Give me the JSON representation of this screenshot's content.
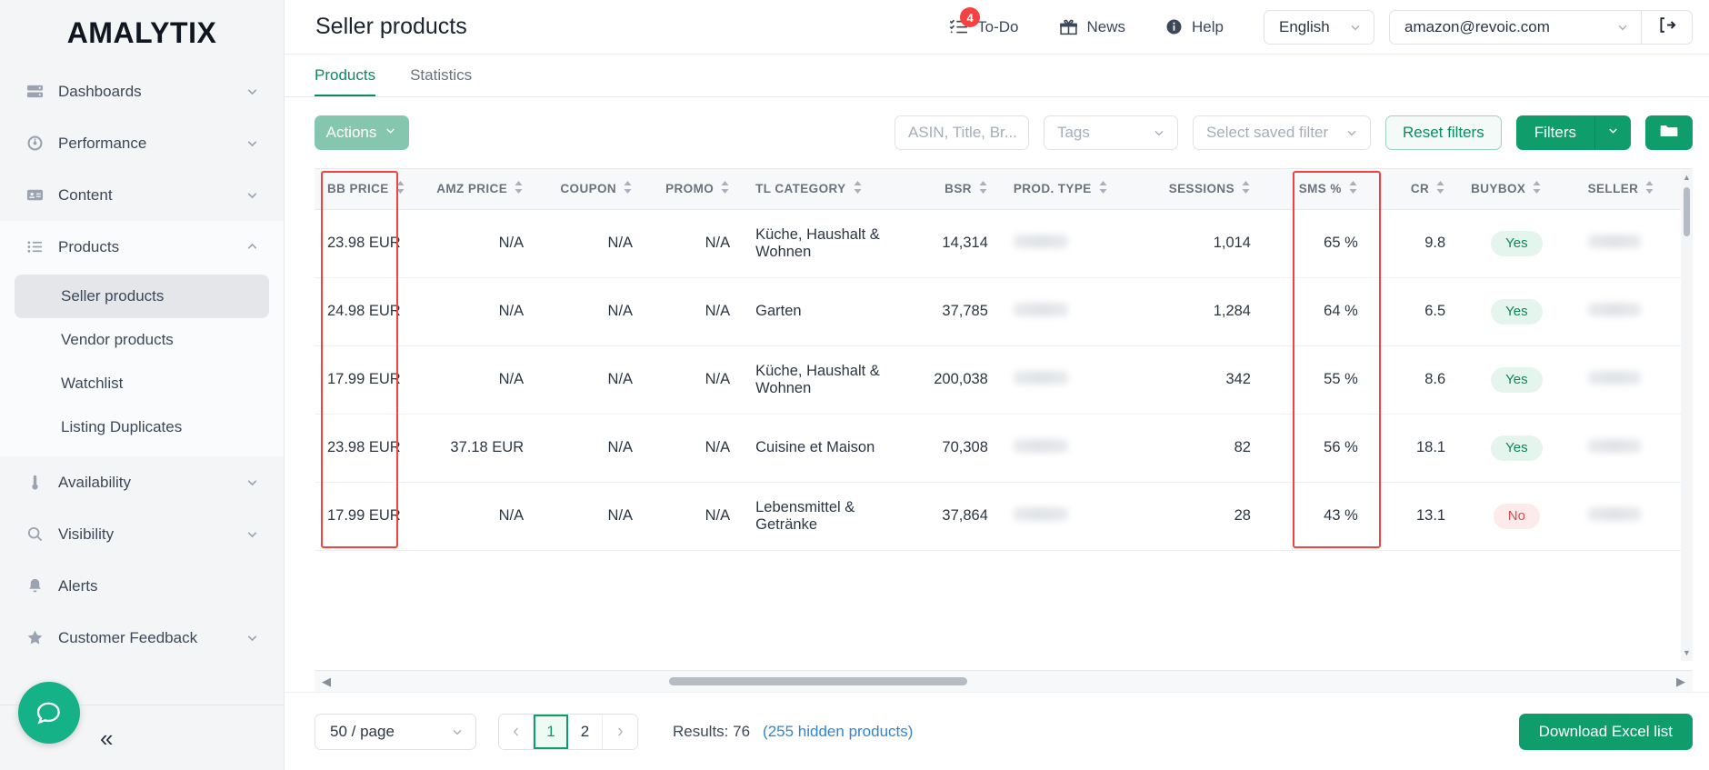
{
  "brand": {
    "name": "AMALYTIX"
  },
  "sidebar": {
    "items": [
      {
        "label": "Dashboards",
        "icon": "dashboard-icon",
        "chevron": "down"
      },
      {
        "label": "Performance",
        "icon": "gauge-icon",
        "chevron": "down"
      },
      {
        "label": "Content",
        "icon": "content-card-icon",
        "chevron": "down"
      },
      {
        "label": "Products",
        "icon": "list-icon",
        "chevron": "up"
      },
      {
        "label": "Availability",
        "icon": "thermometer-icon",
        "chevron": "down"
      },
      {
        "label": "Visibility",
        "icon": "search-icon",
        "chevron": "down"
      },
      {
        "label": "Alerts",
        "icon": "bell-icon",
        "chevron": "none"
      },
      {
        "label": "Customer Feedback",
        "icon": "star-icon",
        "chevron": "down"
      }
    ],
    "products_children": [
      {
        "label": "Seller products",
        "active": true
      },
      {
        "label": "Vendor products",
        "active": false
      },
      {
        "label": "Watchlist",
        "active": false
      },
      {
        "label": "Listing Duplicates",
        "active": false
      }
    ],
    "collapse_icon": "double-chevron-left-icon",
    "chat_icon": "chat-bubble-icon"
  },
  "header": {
    "title": "Seller products",
    "todo": {
      "label": "To-Do",
      "badge": "4",
      "icon": "checklist-icon"
    },
    "news": {
      "label": "News",
      "icon": "gift-icon"
    },
    "help": {
      "label": "Help",
      "icon": "info-icon"
    },
    "language": {
      "value": "English"
    },
    "account": {
      "value": "amazon@revoic.com"
    },
    "logout_icon": "logout-icon"
  },
  "tabs": [
    {
      "label": "Products",
      "active": true
    },
    {
      "label": "Statistics",
      "active": false
    }
  ],
  "toolbar": {
    "actions_label": "Actions",
    "search_placeholder": "ASIN, Title, Br...",
    "tags_placeholder": "Tags",
    "saved_filter_placeholder": "Select saved filter",
    "reset_label": "Reset filters",
    "filters_label": "Filters",
    "folder_icon": "folder-icon"
  },
  "table": {
    "columns": [
      {
        "key": "bb_price",
        "label": "BB PRICE",
        "align": "left",
        "sortable": true
      },
      {
        "key": "amz_price",
        "label": "AMZ PRICE",
        "align": "right",
        "sortable": true
      },
      {
        "key": "coupon",
        "label": "COUPON",
        "align": "right",
        "sortable": true
      },
      {
        "key": "promo",
        "label": "PROMO",
        "align": "right",
        "sortable": true
      },
      {
        "key": "tl_category",
        "label": "TL CATEGORY",
        "align": "left",
        "sortable": true
      },
      {
        "key": "bsr",
        "label": "BSR",
        "align": "right",
        "sortable": true
      },
      {
        "key": "prod_type",
        "label": "PROD. TYPE",
        "align": "left",
        "sortable": true
      },
      {
        "key": "sessions",
        "label": "SESSIONS",
        "align": "right",
        "sortable": true
      },
      {
        "key": "sms",
        "label": "SMS %",
        "align": "right",
        "sortable": true
      },
      {
        "key": "cr",
        "label": "CR",
        "align": "right",
        "sortable": true
      },
      {
        "key": "buybox",
        "label": "BUYBOX",
        "align": "center",
        "sortable": true
      },
      {
        "key": "seller",
        "label": "SELLER",
        "align": "left",
        "sortable": true
      }
    ],
    "rows": [
      {
        "bb_price": "23.98 EUR",
        "amz_price": "N/A",
        "coupon": "N/A",
        "promo": "N/A",
        "tl_category": "Küche, Haushalt & Wohnen",
        "bsr": "14,314",
        "prod_type": "",
        "sessions": "1,014",
        "sms": "65 %",
        "cr": "9.8",
        "buybox": "Yes",
        "seller": ""
      },
      {
        "bb_price": "24.98 EUR",
        "amz_price": "N/A",
        "coupon": "N/A",
        "promo": "N/A",
        "tl_category": "Garten",
        "bsr": "37,785",
        "prod_type": "",
        "sessions": "1,284",
        "sms": "64 %",
        "cr": "6.5",
        "buybox": "Yes",
        "seller": ""
      },
      {
        "bb_price": "17.99 EUR",
        "amz_price": "N/A",
        "coupon": "N/A",
        "promo": "N/A",
        "tl_category": "Küche, Haushalt & Wohnen",
        "bsr": "200,038",
        "prod_type": "",
        "sessions": "342",
        "sms": "55 %",
        "cr": "8.6",
        "buybox": "Yes",
        "seller": ""
      },
      {
        "bb_price": "23.98 EUR",
        "amz_price": "37.18 EUR",
        "coupon": "N/A",
        "promo": "N/A",
        "tl_category": "Cuisine et Maison",
        "bsr": "70,308",
        "prod_type": "",
        "sessions": "82",
        "sms": "56 %",
        "cr": "18.1",
        "buybox": "Yes",
        "seller": ""
      },
      {
        "bb_price": "17.99 EUR",
        "amz_price": "N/A",
        "coupon": "N/A",
        "promo": "N/A",
        "tl_category": "Lebensmittel & Getränke",
        "bsr": "37,864",
        "prod_type": "",
        "sessions": "28",
        "sms": "43 %",
        "cr": "13.1",
        "buybox": "No",
        "seller": ""
      }
    ]
  },
  "footer": {
    "per_page": "50 / page",
    "pages": [
      "1",
      "2"
    ],
    "current_page": "1",
    "prev_icon": "chevron-left-icon",
    "next_icon": "chevron-right-icon",
    "results_label": "Results: 76",
    "hidden_products_label": "(255 hidden products)",
    "download_label": "Download Excel list"
  },
  "colors": {
    "accent_green": "#0f9d6b",
    "tab_green": "#0d8a5f",
    "annotation_red": "#f5413f",
    "link_blue": "#2f86d6",
    "chat_green": "#15b187"
  }
}
